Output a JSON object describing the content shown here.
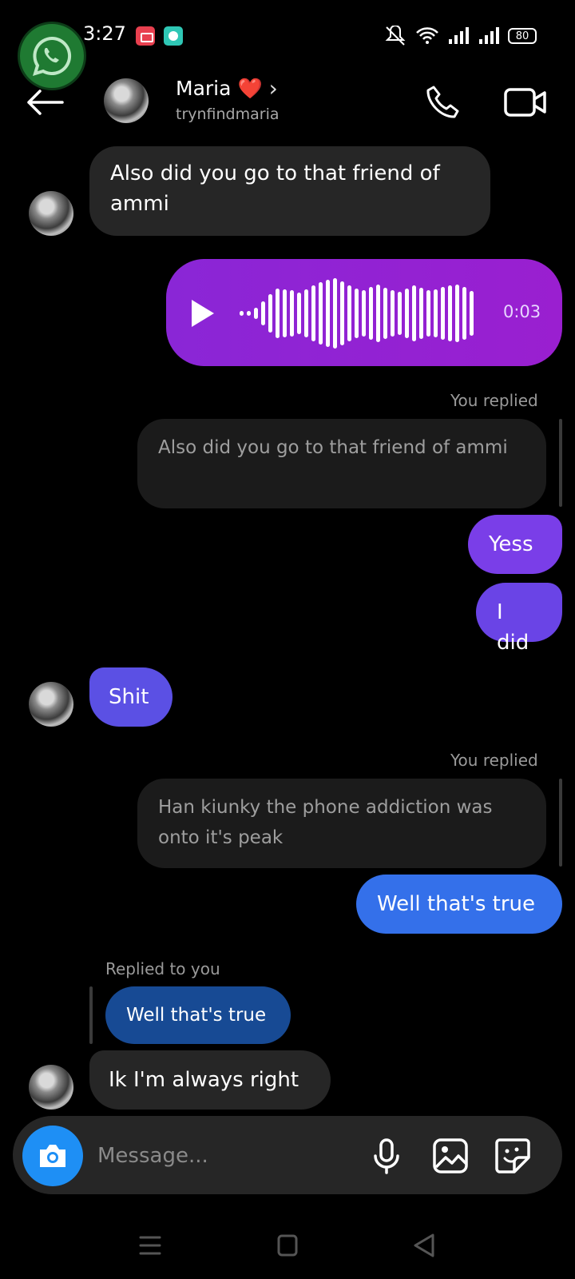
{
  "status": {
    "time": "3:27",
    "battery": "80"
  },
  "header": {
    "name": "Maria",
    "heart": "❤️",
    "chevron": "›",
    "username": "trynfindmaria"
  },
  "messages": {
    "m1_text": "Also did you go to that friend of ammi",
    "voice_duration": "0:03",
    "you_replied": "You replied",
    "quote1": "Also did you go to that friend of ammi",
    "sent1": "Yess",
    "sent2": "I did",
    "in2": "Shit",
    "quote2": "Han kiunky the phone addiction was onto it's peak",
    "sent3": "Well that's true",
    "replied_to_you": "Replied to you",
    "quote3": "Well that's true",
    "in3": "Ik I'm always right"
  },
  "composer": {
    "placeholder": "Message..."
  },
  "colors": {
    "voice_bubble": "#9a1fd0",
    "sent_purple": "#7a3ee8",
    "sent_violet": "#6a44e6",
    "in_indigo": "#5b50e4",
    "sent_blue": "#3470ea",
    "quoted_blue": "#174a94",
    "camera_button": "#1e8ff5"
  },
  "icons": [
    "whatsapp-icon",
    "back-arrow-icon",
    "phone-icon",
    "video-camera-icon",
    "play-icon",
    "camera-icon",
    "microphone-icon",
    "image-icon",
    "sticker-icon"
  ]
}
